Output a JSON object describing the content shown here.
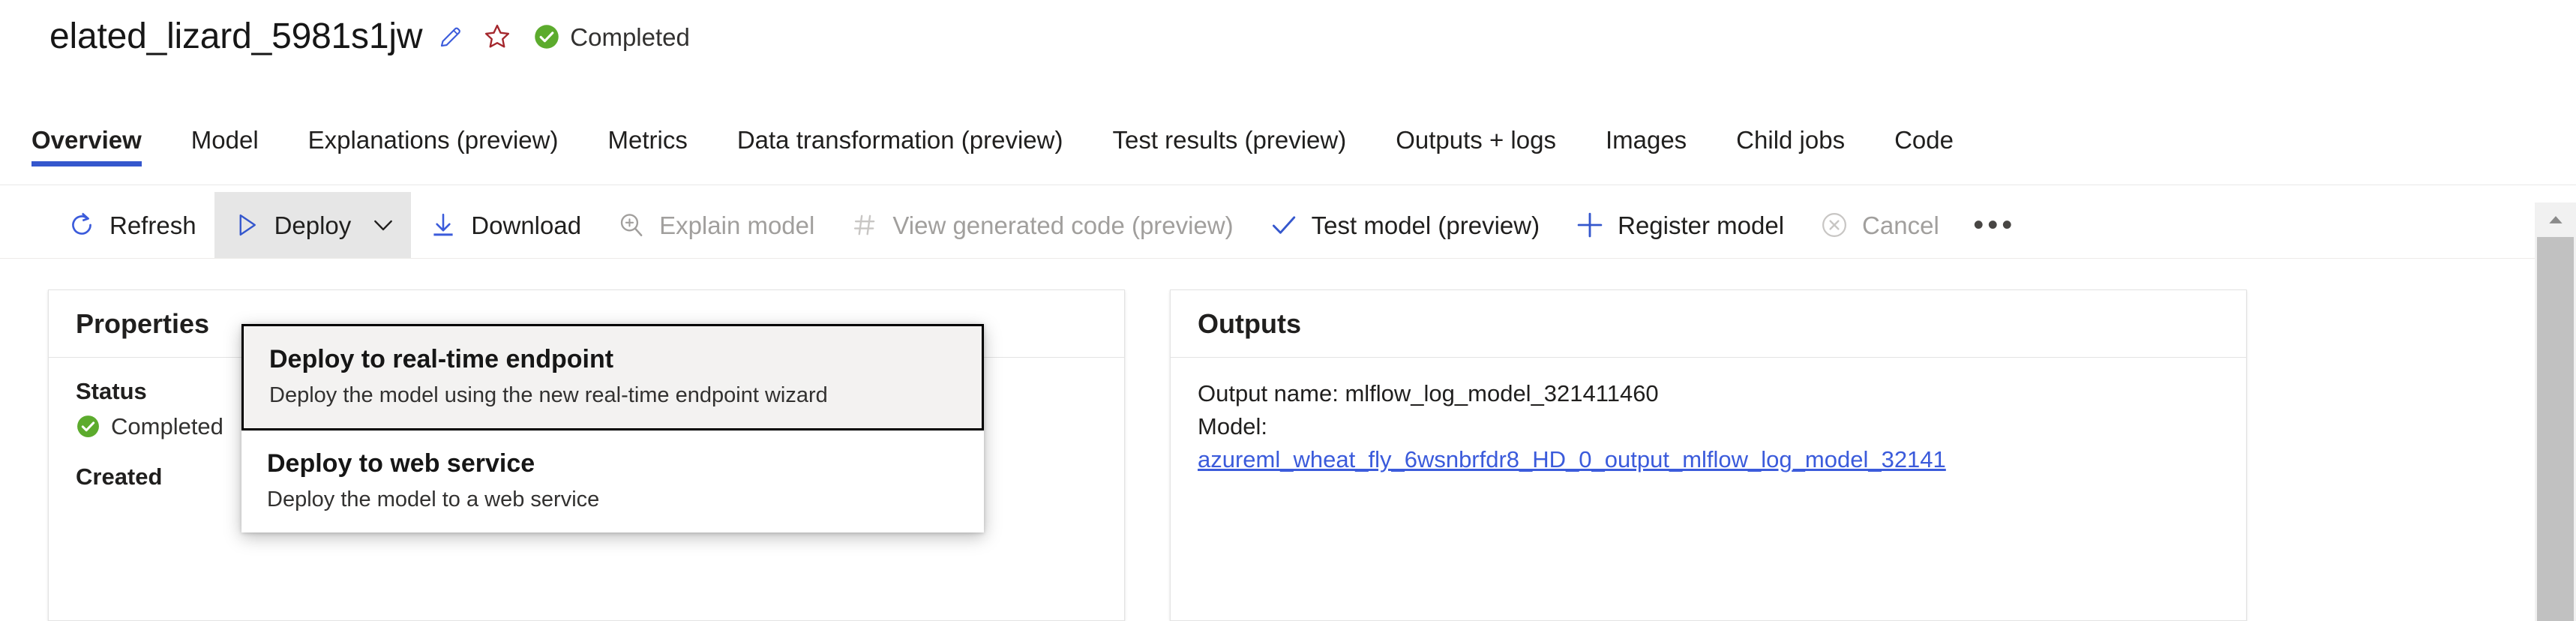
{
  "header": {
    "job_title": "elated_lizard_5981s1jw",
    "edit_icon": "pencil-icon",
    "favorite_icon": "star-icon",
    "status_icon": "check-circle-icon",
    "status_text": "Completed"
  },
  "tabs": [
    {
      "label": "Overview",
      "active": true
    },
    {
      "label": "Model",
      "active": false
    },
    {
      "label": "Explanations (preview)",
      "active": false
    },
    {
      "label": "Metrics",
      "active": false
    },
    {
      "label": "Data transformation (preview)",
      "active": false
    },
    {
      "label": "Test results (preview)",
      "active": false
    },
    {
      "label": "Outputs + logs",
      "active": false
    },
    {
      "label": "Images",
      "active": false
    },
    {
      "label": "Child jobs",
      "active": false
    },
    {
      "label": "Code",
      "active": false
    }
  ],
  "commandbar": {
    "refresh": {
      "label": "Refresh",
      "icon": "refresh-icon"
    },
    "deploy": {
      "label": "Deploy",
      "icon": "play-triangle-icon",
      "chevron": "chevron-down-icon",
      "expanded": true
    },
    "download": {
      "label": "Download",
      "icon": "download-arrow-icon"
    },
    "explain_model": {
      "label": "Explain model",
      "icon": "magnifier-plus-icon",
      "disabled": true
    },
    "view_generated_code": {
      "label": "View generated code (preview)",
      "icon": "hash-icon",
      "disabled": true
    },
    "test_model": {
      "label": "Test model (preview)",
      "icon": "checkmark-icon"
    },
    "register_model": {
      "label": "Register model",
      "icon": "plus-icon"
    },
    "cancel": {
      "label": "Cancel",
      "icon": "cancel-circle-icon",
      "disabled": true
    },
    "overflow": {
      "label": "•••",
      "icon": "more-horizontal-icon"
    }
  },
  "deploy_menu": {
    "items": [
      {
        "title": "Deploy to real-time endpoint",
        "desc": "Deploy the model using the new real-time endpoint wizard",
        "highlighted": true
      },
      {
        "title": "Deploy to web service",
        "desc": "Deploy the model to a web service",
        "highlighted": false
      }
    ]
  },
  "properties_panel": {
    "title": "Properties",
    "status_label": "Status",
    "status_icon": "check-circle-icon",
    "status_value": "Completed",
    "next_label": "Created"
  },
  "outputs_panel": {
    "title": "Outputs",
    "output_name_line": "Output name: mlflow_log_model_321411460",
    "model_label": "Model:",
    "model_link": "azureml_wheat_fly_6wsnbrfdr8_HD_0_output_mlflow_log_model_32141"
  },
  "scrollbar": {
    "up_arrow_icon": "scroll-up-arrow-icon"
  },
  "colors": {
    "accent_blue": "#3557cd",
    "link_blue": "#3b5bdb",
    "success_green": "#5cab2d",
    "star_red": "#a4262c",
    "disabled_gray": "#a19f9d",
    "toolbar_selected": "#e6e6e6"
  }
}
